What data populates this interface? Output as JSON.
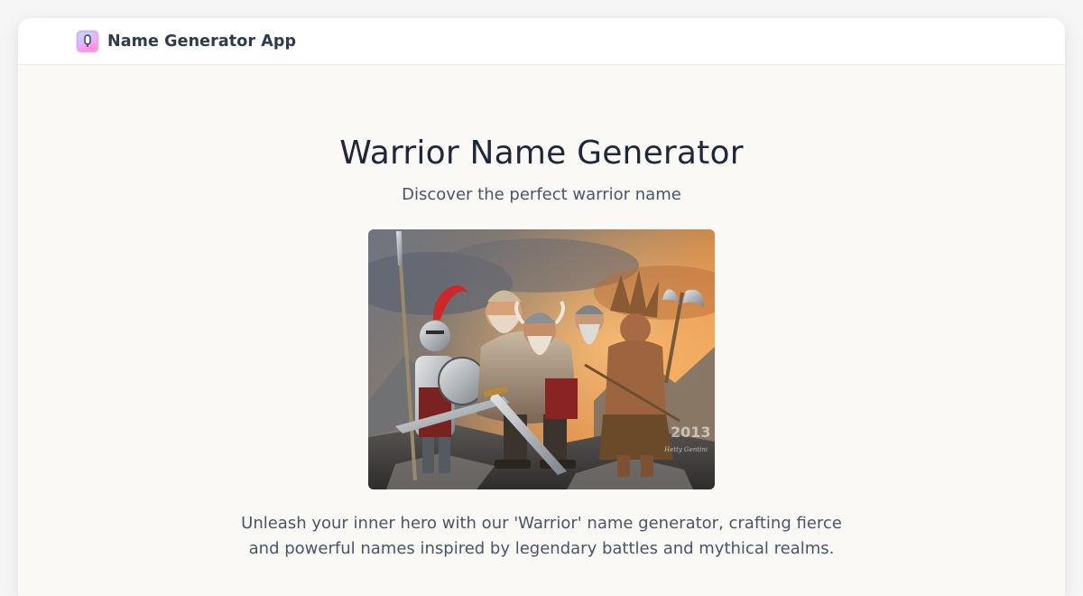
{
  "header": {
    "app_name": "Name Generator App",
    "logo_icon": "microphone-icon"
  },
  "main": {
    "title": "Warrior Name Generator",
    "subtitle": "Discover the perfect warrior name",
    "hero_image": {
      "overlay_text": "2013",
      "signature_text": "Hetty Gentini"
    },
    "description": "Unleash your inner hero with our 'Warrior' name generator, crafting fierce and powerful names inspired by legendary battles and mythical realms."
  },
  "colors": {
    "page_bg": "#faf9f6",
    "header_bg": "#ffffff",
    "title_text": "#1f2738",
    "body_text": "#4a5466",
    "brand_text": "#2f3a4a"
  }
}
